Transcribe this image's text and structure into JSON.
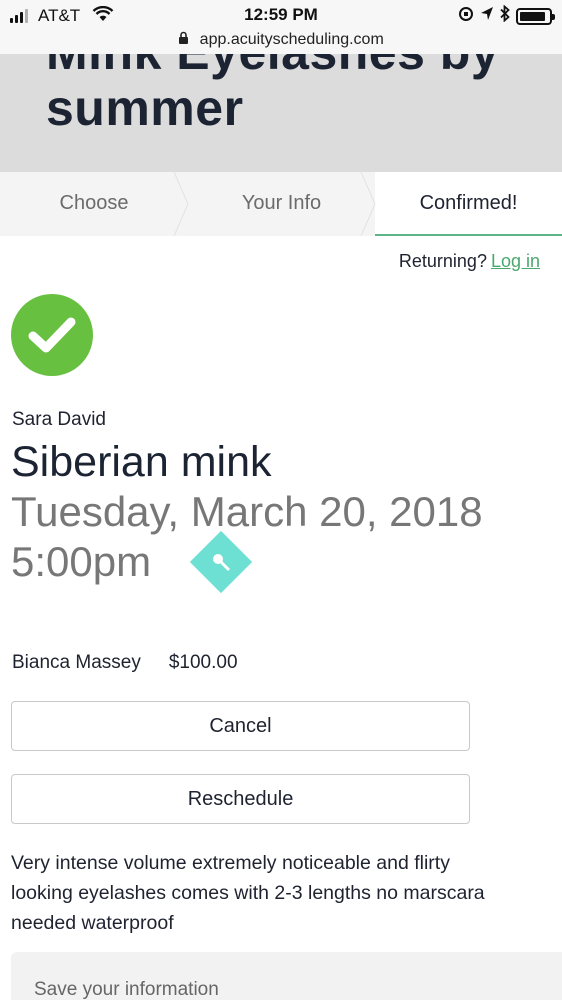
{
  "status_bar": {
    "carrier": "AT&T",
    "time": "12:59 PM",
    "battery_level": 0.9
  },
  "browser": {
    "url": "app.acuityscheduling.com"
  },
  "header": {
    "title": "Mink Eyelashes by summer"
  },
  "steps": [
    {
      "label": "Choose"
    },
    {
      "label": "Your Info"
    },
    {
      "label": "Confirmed!"
    }
  ],
  "returning": {
    "text": "Returning?",
    "link": "Log in"
  },
  "confirmation": {
    "client_name": "Sara David",
    "service": "Siberian mink",
    "date": "Tuesday, March 20, 2018",
    "time": "5:00pm",
    "provider": "Bianca Massey",
    "price": "$100.00"
  },
  "buttons": {
    "cancel": "Cancel",
    "reschedule": "Reschedule"
  },
  "description": "Very intense volume extremely noticeable and flirty looking eyelashes comes with 2-3 lengths no marscara needed waterproof",
  "save_box": {
    "label": "Save your information"
  },
  "colors": {
    "accent": "#4aa86f",
    "check": "#67c040",
    "header_bg": "#dcdcdc"
  }
}
